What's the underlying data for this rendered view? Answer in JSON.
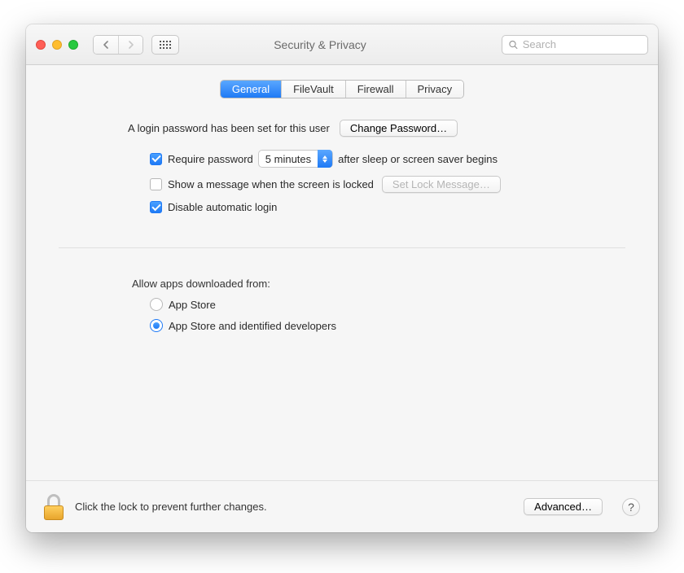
{
  "header": {
    "title": "Security & Privacy",
    "search_placeholder": "Search"
  },
  "tabs": [
    {
      "id": "general",
      "label": "General",
      "active": true
    },
    {
      "id": "filevault",
      "label": "FileVault",
      "active": false
    },
    {
      "id": "firewall",
      "label": "Firewall",
      "active": false
    },
    {
      "id": "privacy",
      "label": "Privacy",
      "active": false
    }
  ],
  "login": {
    "status_text": "A login password has been set for this user",
    "change_password_label": "Change Password…",
    "require_password": {
      "checked": true,
      "label_before": "Require password",
      "delay_value": "5 minutes",
      "label_after": "after sleep or screen saver begins"
    },
    "show_message": {
      "checked": false,
      "label": "Show a message when the screen is locked",
      "button_label": "Set Lock Message…",
      "button_enabled": false
    },
    "disable_auto_login": {
      "checked": true,
      "label": "Disable automatic login"
    }
  },
  "gatekeeper": {
    "heading": "Allow apps downloaded from:",
    "options": [
      {
        "id": "appstore",
        "label": "App Store",
        "selected": false
      },
      {
        "id": "identified",
        "label": "App Store and identified developers",
        "selected": true
      }
    ]
  },
  "footer": {
    "lock_text": "Click the lock to prevent further changes.",
    "advanced_label": "Advanced…",
    "help_label": "?"
  }
}
